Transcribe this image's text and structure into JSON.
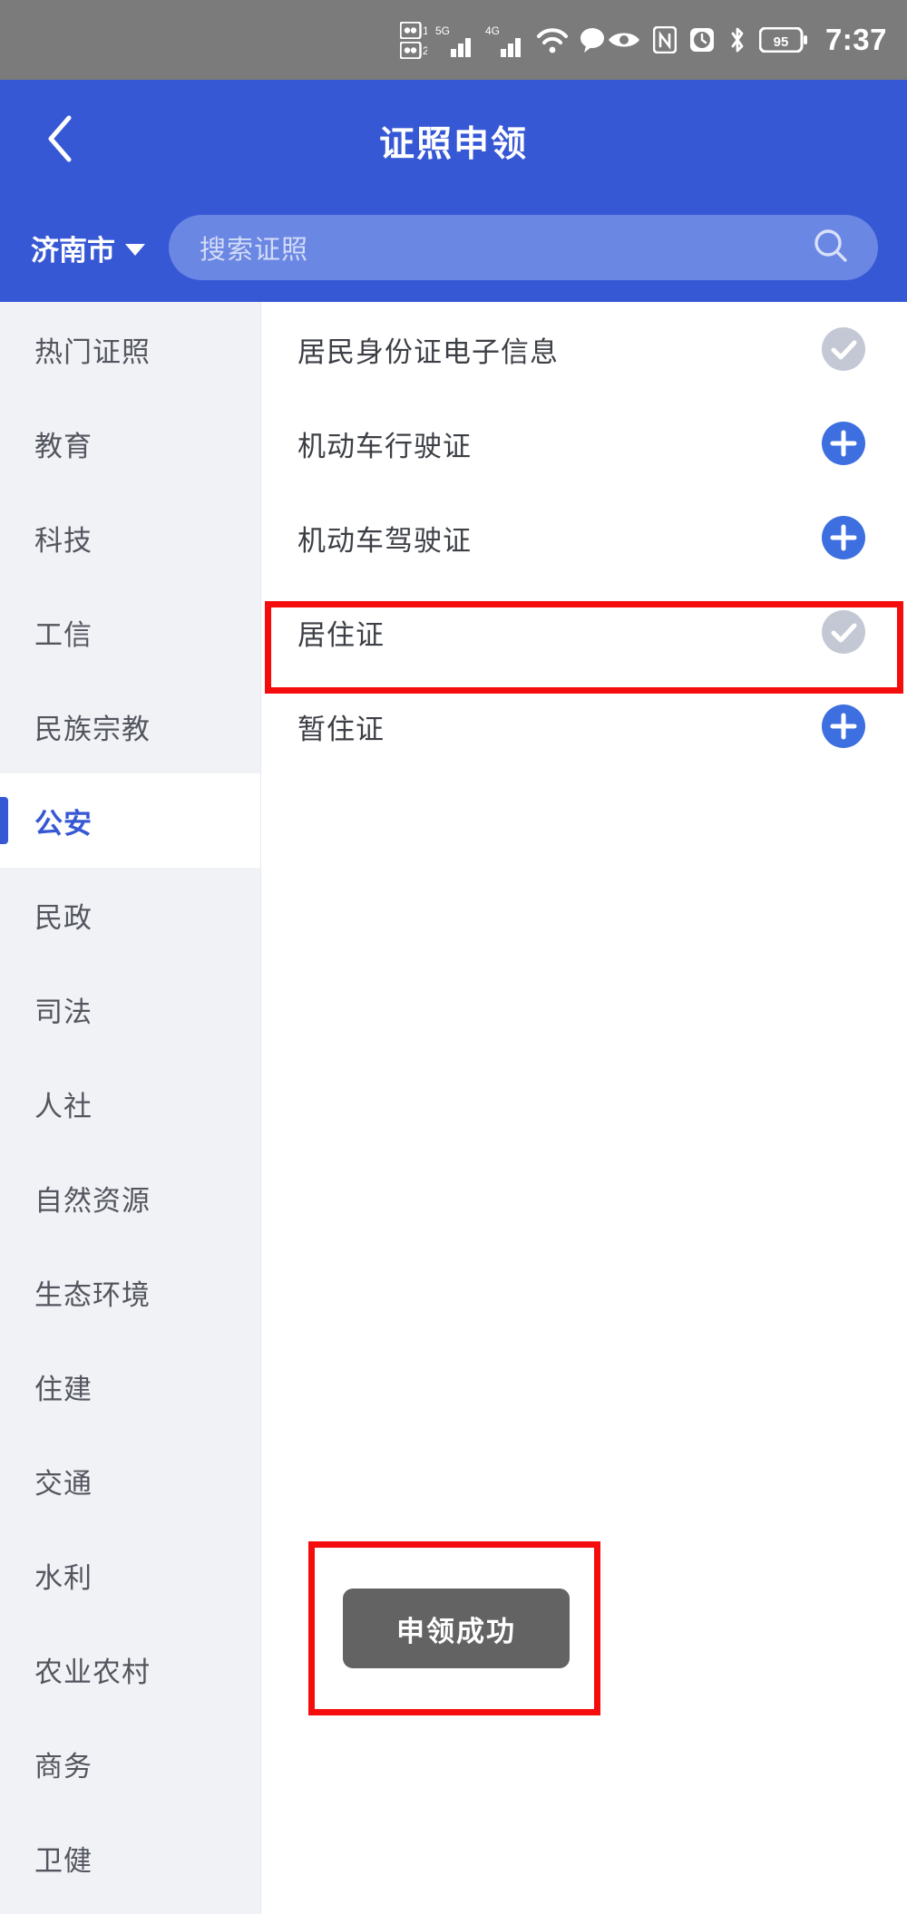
{
  "status_bar": {
    "time": "7:37",
    "battery_level": "95",
    "left_icons": [],
    "mid_icons": [
      "sim-card-1-icon",
      "sim-card-2-icon",
      "signal-5g-icon",
      "signal-4g-icon",
      "wifi-icon",
      "message-bubble-icon"
    ],
    "right_icons": [
      "eye-care-icon",
      "nfc-icon",
      "alarm-icon",
      "bluetooth-icon",
      "battery-icon"
    ],
    "background": "#7b7b7b"
  },
  "header": {
    "title": "证照申领",
    "back_icon": "chevron-left-icon",
    "background": "#3758d4",
    "city_selector": {
      "label": "济南市",
      "caret_icon": "caret-down-icon"
    },
    "search": {
      "placeholder": "搜索证照",
      "value": "",
      "icon": "search-icon"
    }
  },
  "sidebar": {
    "active_index": 5,
    "items": [
      {
        "label": "热门证照"
      },
      {
        "label": "教育"
      },
      {
        "label": "科技"
      },
      {
        "label": "工信"
      },
      {
        "label": "民族宗教"
      },
      {
        "label": "公安"
      },
      {
        "label": "民政"
      },
      {
        "label": "司法"
      },
      {
        "label": "人社"
      },
      {
        "label": "自然资源"
      },
      {
        "label": "生态环境"
      },
      {
        "label": "住建"
      },
      {
        "label": "交通"
      },
      {
        "label": "水利"
      },
      {
        "label": "农业农村"
      },
      {
        "label": "商务"
      },
      {
        "label": "卫健"
      }
    ]
  },
  "main_list": {
    "rows": [
      {
        "label": "居民身份证电子信息",
        "state": "applied",
        "icon": "check-circle-icon"
      },
      {
        "label": "机动车行驶证",
        "state": "available",
        "icon": "plus-circle-icon"
      },
      {
        "label": "机动车驾驶证",
        "state": "available",
        "icon": "plus-circle-icon"
      },
      {
        "label": "居住证",
        "state": "applied",
        "icon": "check-circle-icon"
      },
      {
        "label": "暂住证",
        "state": "available",
        "icon": "plus-circle-icon"
      }
    ]
  },
  "toast": {
    "message": "申领成功"
  },
  "annotations": {
    "highlight_color": "#f50d0d",
    "boxes": [
      {
        "target": "居住证",
        "name": "annotation-box-row"
      },
      {
        "target": "申领成功",
        "name": "annotation-box-toast"
      }
    ]
  },
  "colors": {
    "brand_blue": "#3758d4",
    "plus_blue": "#3d6fe0",
    "check_gray": "#c3c8d4",
    "toast_gray": "#636363",
    "sidebar_bg": "#f0f2f6",
    "annotation_red": "#f50d0d"
  }
}
